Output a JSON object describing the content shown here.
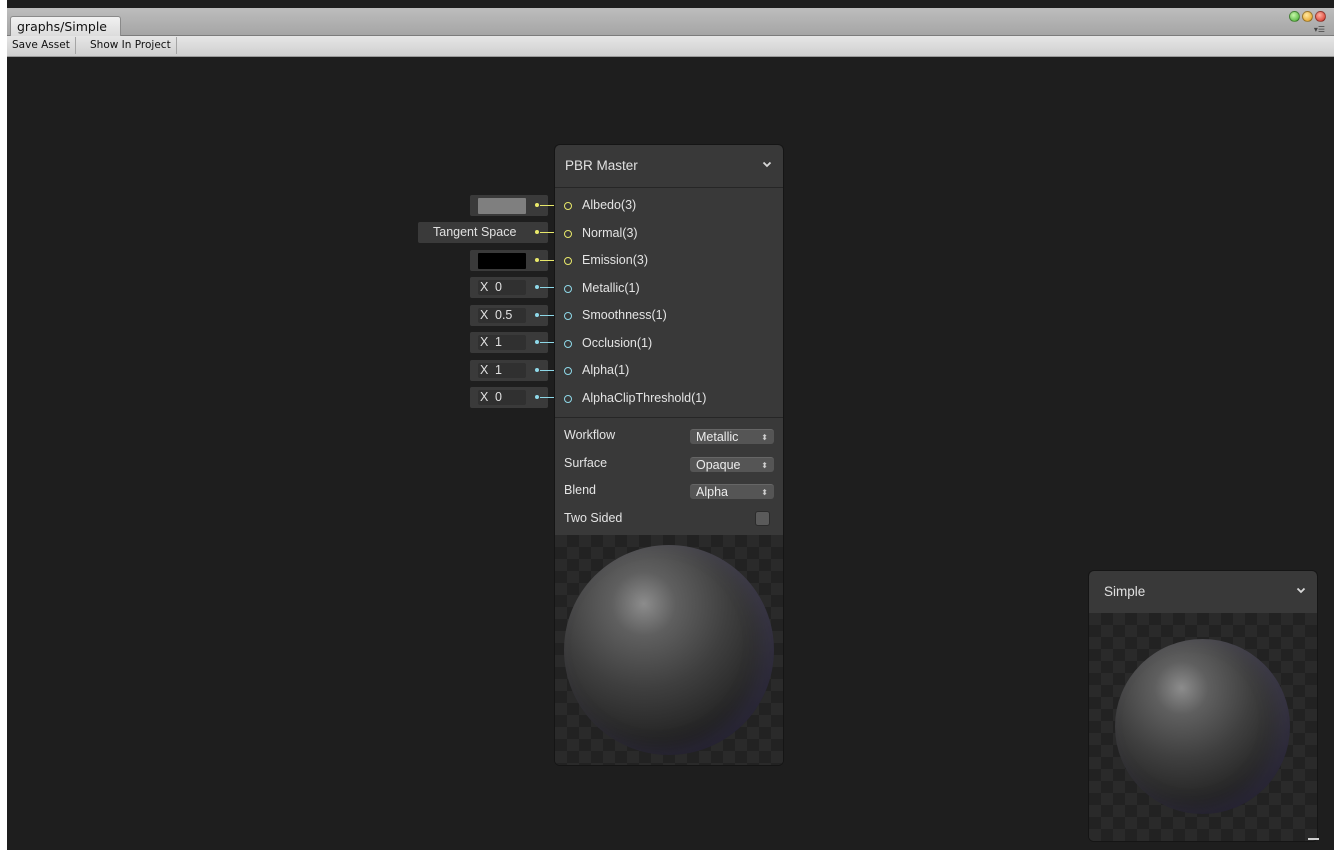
{
  "window": {
    "tab_title": "graphs/Simple"
  },
  "toolbar": {
    "save_asset": "Save Asset",
    "show_in_project": "Show In Project"
  },
  "colors": {
    "vector3_port": "#e8e86a",
    "vector1_port": "#8ed8e8",
    "albedo_swatch": "#7f7f7f",
    "emission_swatch": "#000000"
  },
  "master_node": {
    "title": "PBR Master",
    "ports": [
      {
        "label": "Albedo(3)",
        "type": "vector3"
      },
      {
        "label": "Normal(3)",
        "type": "vector3"
      },
      {
        "label": "Emission(3)",
        "type": "vector3"
      },
      {
        "label": "Metallic(1)",
        "type": "vector1"
      },
      {
        "label": "Smoothness(1)",
        "type": "vector1"
      },
      {
        "label": "Occlusion(1)",
        "type": "vector1"
      },
      {
        "label": "Alpha(1)",
        "type": "vector1"
      },
      {
        "label": "AlphaClipThreshold(1)",
        "type": "vector1"
      }
    ],
    "workflow": {
      "label": "Workflow",
      "value": "Metallic"
    },
    "surface": {
      "label": "Surface",
      "value": "Opaque"
    },
    "blend": {
      "label": "Blend",
      "value": "Alpha"
    },
    "two_sided": {
      "label": "Two Sided",
      "checked": false
    }
  },
  "inputs": {
    "normal_space": "Tangent Space",
    "metallic": {
      "axis": "X",
      "value": "0"
    },
    "smoothness": {
      "axis": "X",
      "value": "0.5"
    },
    "occlusion": {
      "axis": "X",
      "value": "1"
    },
    "alpha": {
      "axis": "X",
      "value": "1"
    },
    "alpha_clip": {
      "axis": "X",
      "value": "0"
    }
  },
  "preview_node": {
    "title": "Simple"
  }
}
